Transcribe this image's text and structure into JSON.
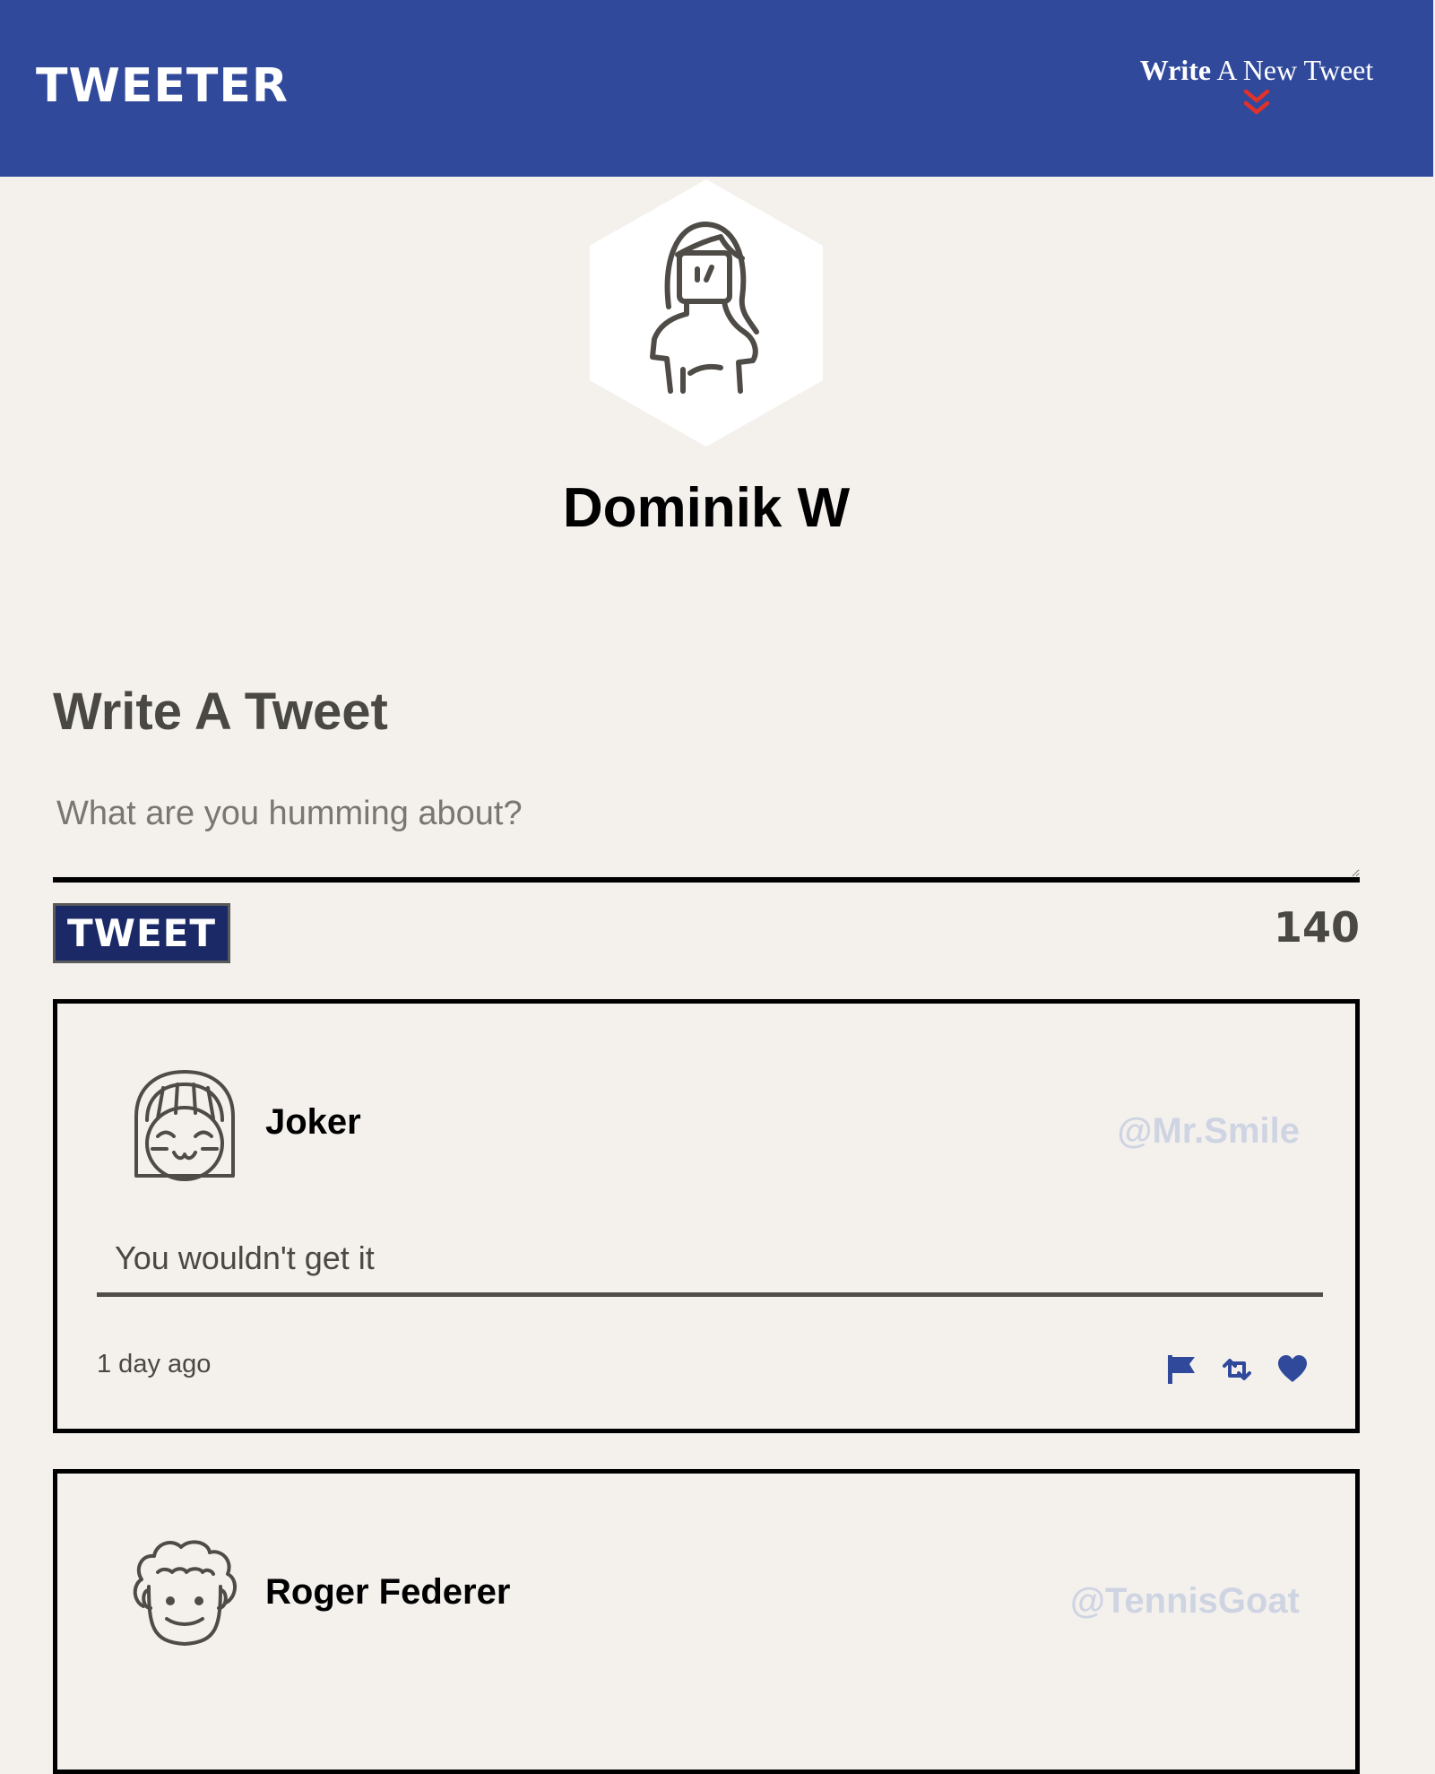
{
  "nav": {
    "brand": "TWEETER",
    "compose_toggle": {
      "bold": "Write",
      "rest": "A New Tweet"
    },
    "icons": {
      "compose_toggle": "double-chevron-down-icon"
    },
    "colors": {
      "bar": "#30499b",
      "chevron": "#e0322b"
    }
  },
  "profile": {
    "name": "Dominik W",
    "avatar_icon": "woman-avatar-icon"
  },
  "compose": {
    "title": "Write A Tweet",
    "placeholder": "What are you humming about?",
    "value": "",
    "submit_label": "TWEET",
    "counter": "140"
  },
  "tweets": [
    {
      "author": "Joker",
      "handle": "@Mr.Smile",
      "content": "You wouldn't get it",
      "time": "1 day ago",
      "avatar_icon": "smiling-face-avatar-icon",
      "actions": [
        "flag-icon",
        "retweet-icon",
        "heart-icon"
      ]
    },
    {
      "author": "Roger Federer",
      "handle": "@TennisGoat",
      "avatar_icon": "curly-hair-avatar-icon"
    }
  ],
  "colors": {
    "page_bg": "#f4f1ed",
    "accent": "#30499b",
    "button": "#1b2a66",
    "handle": "#cfd4e3",
    "action_icons": "#30499b"
  }
}
